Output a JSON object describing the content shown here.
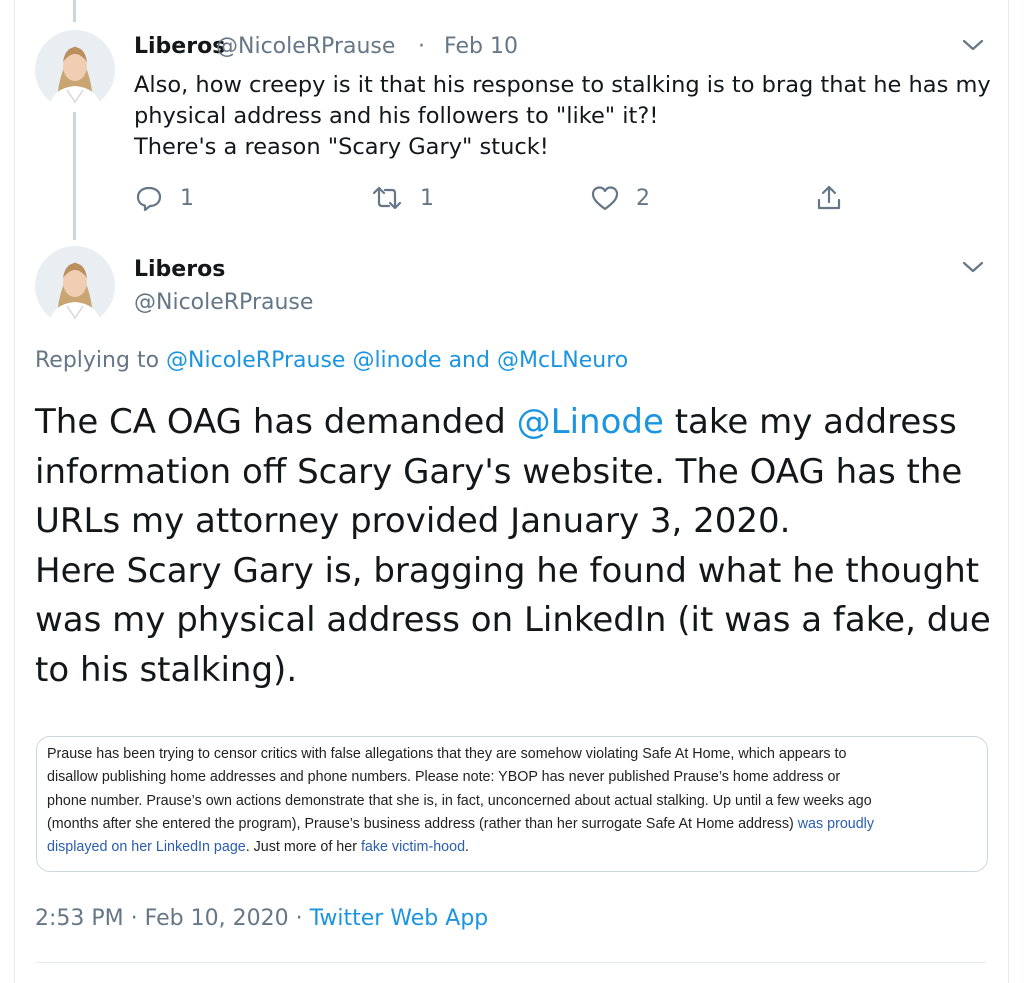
{
  "tweet1": {
    "name": "Liberos",
    "handle": "@NicoleRPrause",
    "separator": "·",
    "date": "Feb 10",
    "lines": [
      "Also, how creepy is it that his response to stalking is to brag that he has my",
      "physical address and his followers to \"like\" it?!",
      "There's a reason \"Scary Gary\" stuck!"
    ],
    "reply_count": "1",
    "retweet_count": "1",
    "like_count": "2"
  },
  "tweet2": {
    "name": "Liberos",
    "handle": "@NicoleRPrause",
    "replying_prefix": "Replying to",
    "replying_handle1": "@NicoleRPrause",
    "replying_handle2": "@linode",
    "replying_and": "and",
    "replying_handle3": "@McLNeuro",
    "body_line1_pre": "The CA OAG has demanded ",
    "body_line1_link": "@Linode",
    "body_line1_post": " take my address",
    "body_lines": [
      "information off Scary Gary's website. The OAG has the",
      "URLs my attorney provided January 3, 2020.",
      "Here Scary Gary is, bragging he found what he thought",
      "was my physical address on LinkedIn (it was a fake, due",
      "to his stalking)."
    ],
    "quote": {
      "lines": [
        "Prause has been trying to censor critics with false allegations that they are somehow violating Safe At Home, which appears to",
        "disallow publishing home addresses and phone numbers. Please note: YBOP has never published Prause’s home address or",
        "phone number. Prause’s own actions demonstrate that she is, in fact, unconcerned about actual stalking. Up until a few weeks ago"
      ],
      "line4_text": "(months after she entered the program), Prause’s business address (rather than her surrogate Safe At Home address) ",
      "line4_link": "was proudly",
      "line5_link": "displayed on her LinkedIn page",
      "line5_mid": ". Just more of her ",
      "line5_link2": "fake victim-hood",
      "line5_end": "."
    },
    "time": "2:53 PM",
    "separator": "·",
    "date": "Feb 10, 2020",
    "separator2": "·",
    "source": "Twitter Web App"
  },
  "colors": {
    "link": "#1b95e0",
    "muted": "#657786",
    "text": "#14171a",
    "border": "#e6ecf0",
    "quote_link": "#2a5db0"
  }
}
